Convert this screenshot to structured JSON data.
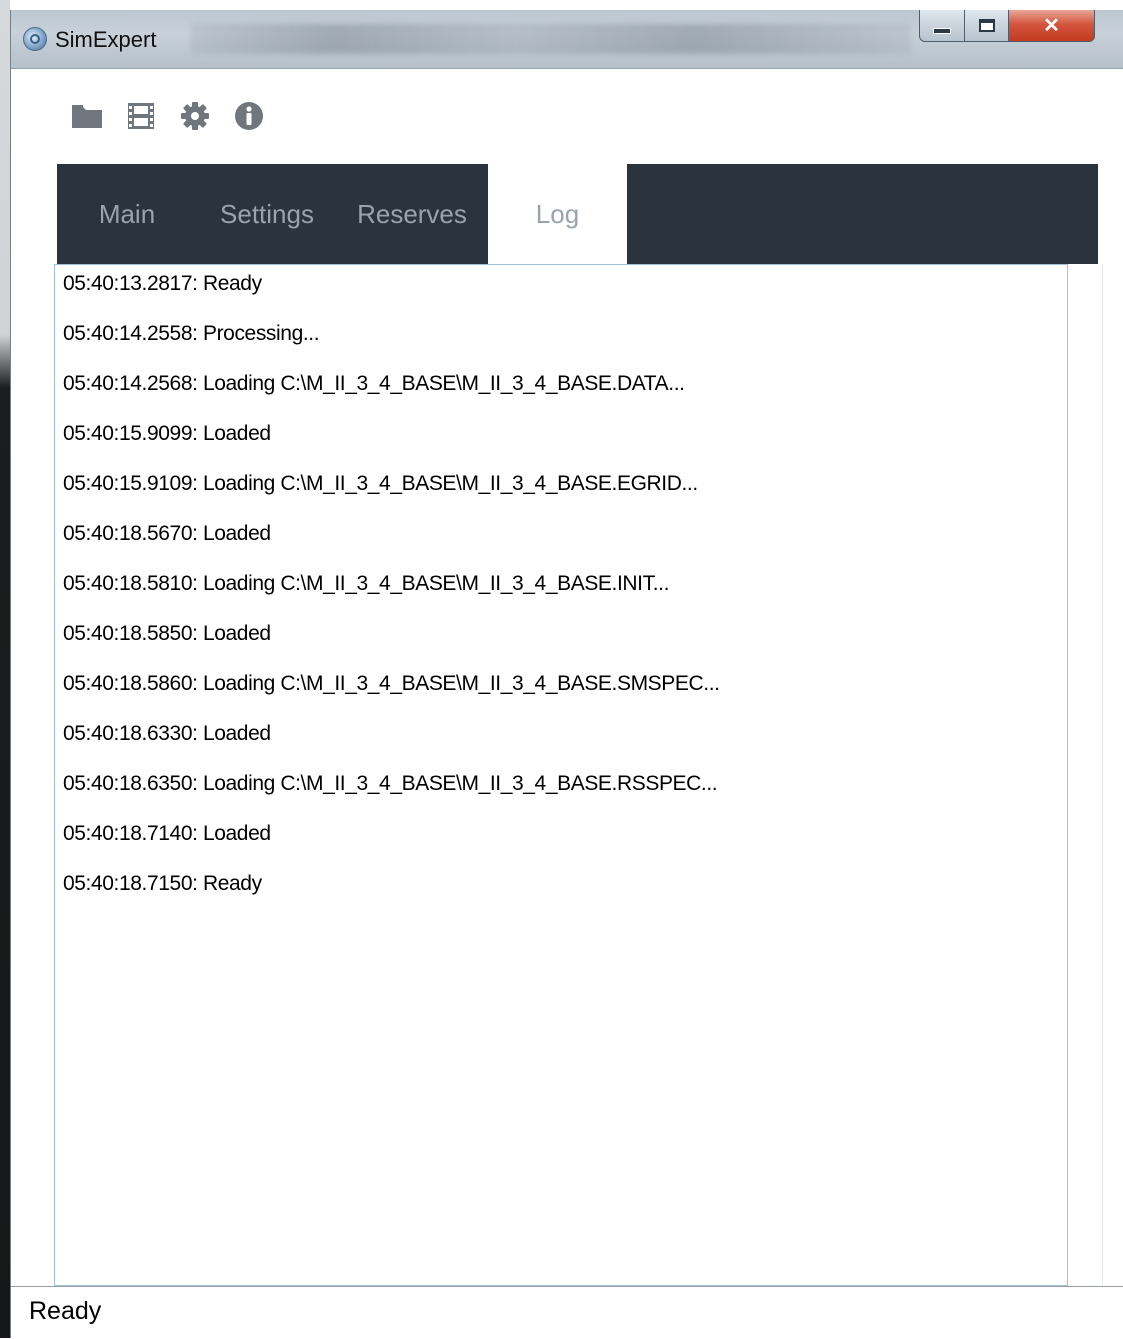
{
  "window": {
    "title": "SimExpert"
  },
  "toolbar": {
    "icons": [
      "folder-icon",
      "film-icon",
      "gear-icon",
      "info-icon"
    ]
  },
  "tabs": [
    {
      "label": "Main",
      "active": false
    },
    {
      "label": "Settings",
      "active": false
    },
    {
      "label": "Reserves",
      "active": false
    },
    {
      "label": "Log",
      "active": true
    }
  ],
  "log": {
    "lines": [
      "05:40:13.2817: Ready",
      "05:40:14.2558: Processing...",
      "05:40:14.2568: Loading C:\\M_II_3_4_BASE\\M_II_3_4_BASE.DATA...",
      "05:40:15.9099: Loaded",
      "05:40:15.9109: Loading C:\\M_II_3_4_BASE\\M_II_3_4_BASE.EGRID...",
      "05:40:18.5670: Loaded",
      "05:40:18.5810: Loading C:\\M_II_3_4_BASE\\M_II_3_4_BASE.INIT...",
      "05:40:18.5850: Loaded",
      "05:40:18.5860: Loading C:\\M_II_3_4_BASE\\M_II_3_4_BASE.SMSPEC...",
      "05:40:18.6330: Loaded",
      "05:40:18.6350: Loading C:\\M_II_3_4_BASE\\M_II_3_4_BASE.RSSPEC...",
      "05:40:18.7140: Loaded",
      "05:40:18.7150: Ready"
    ]
  },
  "statusbar": {
    "text": "Ready"
  },
  "colors": {
    "tab_strip": "#2b333d",
    "tab_text": "#9aa3ad",
    "toolbar_icon": "#6f767d",
    "close_button": "#c94a31",
    "log_border": "#9ec3de"
  }
}
